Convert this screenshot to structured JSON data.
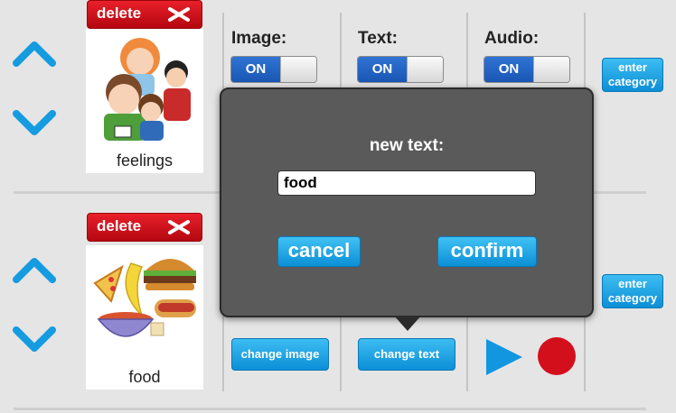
{
  "rows": [
    {
      "card_label": "feelings",
      "delete_label": "delete",
      "category_button": "enter category"
    },
    {
      "card_label": "food",
      "delete_label": "delete",
      "category_button": "enter category"
    }
  ],
  "settings": {
    "image_label": "Image:",
    "text_label": "Text:",
    "audio_label": "Audio:",
    "toggle_on": "ON"
  },
  "buttons": {
    "change_image": "change image",
    "change_text": "change text"
  },
  "dialog": {
    "title": "new text:",
    "input_value": "food",
    "cancel": "cancel",
    "confirm": "confirm"
  },
  "colors": {
    "accent_blue": "#0c8fd6",
    "delete_red": "#c50d16",
    "record_red": "#d40f1c",
    "play_blue": "#1296e0"
  }
}
